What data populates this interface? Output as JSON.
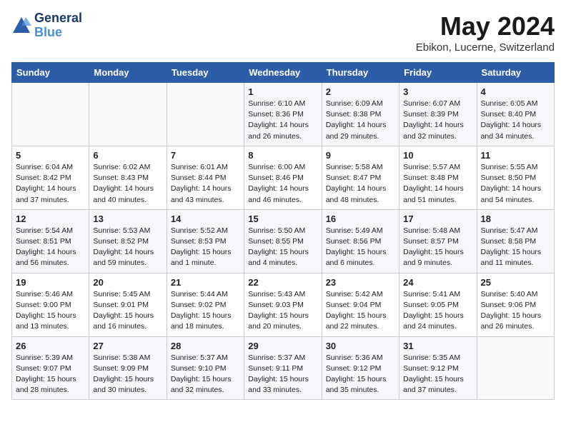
{
  "header": {
    "logo_line1": "General",
    "logo_line2": "Blue",
    "month": "May 2024",
    "location": "Ebikon, Lucerne, Switzerland"
  },
  "days_of_week": [
    "Sunday",
    "Monday",
    "Tuesday",
    "Wednesday",
    "Thursday",
    "Friday",
    "Saturday"
  ],
  "weeks": [
    [
      {
        "day": "",
        "content": ""
      },
      {
        "day": "",
        "content": ""
      },
      {
        "day": "",
        "content": ""
      },
      {
        "day": "1",
        "content": "Sunrise: 6:10 AM\nSunset: 8:36 PM\nDaylight: 14 hours\nand 26 minutes."
      },
      {
        "day": "2",
        "content": "Sunrise: 6:09 AM\nSunset: 8:38 PM\nDaylight: 14 hours\nand 29 minutes."
      },
      {
        "day": "3",
        "content": "Sunrise: 6:07 AM\nSunset: 8:39 PM\nDaylight: 14 hours\nand 32 minutes."
      },
      {
        "day": "4",
        "content": "Sunrise: 6:05 AM\nSunset: 8:40 PM\nDaylight: 14 hours\nand 34 minutes."
      }
    ],
    [
      {
        "day": "5",
        "content": "Sunrise: 6:04 AM\nSunset: 8:42 PM\nDaylight: 14 hours\nand 37 minutes."
      },
      {
        "day": "6",
        "content": "Sunrise: 6:02 AM\nSunset: 8:43 PM\nDaylight: 14 hours\nand 40 minutes."
      },
      {
        "day": "7",
        "content": "Sunrise: 6:01 AM\nSunset: 8:44 PM\nDaylight: 14 hours\nand 43 minutes."
      },
      {
        "day": "8",
        "content": "Sunrise: 6:00 AM\nSunset: 8:46 PM\nDaylight: 14 hours\nand 46 minutes."
      },
      {
        "day": "9",
        "content": "Sunrise: 5:58 AM\nSunset: 8:47 PM\nDaylight: 14 hours\nand 48 minutes."
      },
      {
        "day": "10",
        "content": "Sunrise: 5:57 AM\nSunset: 8:48 PM\nDaylight: 14 hours\nand 51 minutes."
      },
      {
        "day": "11",
        "content": "Sunrise: 5:55 AM\nSunset: 8:50 PM\nDaylight: 14 hours\nand 54 minutes."
      }
    ],
    [
      {
        "day": "12",
        "content": "Sunrise: 5:54 AM\nSunset: 8:51 PM\nDaylight: 14 hours\nand 56 minutes."
      },
      {
        "day": "13",
        "content": "Sunrise: 5:53 AM\nSunset: 8:52 PM\nDaylight: 14 hours\nand 59 minutes."
      },
      {
        "day": "14",
        "content": "Sunrise: 5:52 AM\nSunset: 8:53 PM\nDaylight: 15 hours\nand 1 minute."
      },
      {
        "day": "15",
        "content": "Sunrise: 5:50 AM\nSunset: 8:55 PM\nDaylight: 15 hours\nand 4 minutes."
      },
      {
        "day": "16",
        "content": "Sunrise: 5:49 AM\nSunset: 8:56 PM\nDaylight: 15 hours\nand 6 minutes."
      },
      {
        "day": "17",
        "content": "Sunrise: 5:48 AM\nSunset: 8:57 PM\nDaylight: 15 hours\nand 9 minutes."
      },
      {
        "day": "18",
        "content": "Sunrise: 5:47 AM\nSunset: 8:58 PM\nDaylight: 15 hours\nand 11 minutes."
      }
    ],
    [
      {
        "day": "19",
        "content": "Sunrise: 5:46 AM\nSunset: 9:00 PM\nDaylight: 15 hours\nand 13 minutes."
      },
      {
        "day": "20",
        "content": "Sunrise: 5:45 AM\nSunset: 9:01 PM\nDaylight: 15 hours\nand 16 minutes."
      },
      {
        "day": "21",
        "content": "Sunrise: 5:44 AM\nSunset: 9:02 PM\nDaylight: 15 hours\nand 18 minutes."
      },
      {
        "day": "22",
        "content": "Sunrise: 5:43 AM\nSunset: 9:03 PM\nDaylight: 15 hours\nand 20 minutes."
      },
      {
        "day": "23",
        "content": "Sunrise: 5:42 AM\nSunset: 9:04 PM\nDaylight: 15 hours\nand 22 minutes."
      },
      {
        "day": "24",
        "content": "Sunrise: 5:41 AM\nSunset: 9:05 PM\nDaylight: 15 hours\nand 24 minutes."
      },
      {
        "day": "25",
        "content": "Sunrise: 5:40 AM\nSunset: 9:06 PM\nDaylight: 15 hours\nand 26 minutes."
      }
    ],
    [
      {
        "day": "26",
        "content": "Sunrise: 5:39 AM\nSunset: 9:07 PM\nDaylight: 15 hours\nand 28 minutes."
      },
      {
        "day": "27",
        "content": "Sunrise: 5:38 AM\nSunset: 9:09 PM\nDaylight: 15 hours\nand 30 minutes."
      },
      {
        "day": "28",
        "content": "Sunrise: 5:37 AM\nSunset: 9:10 PM\nDaylight: 15 hours\nand 32 minutes."
      },
      {
        "day": "29",
        "content": "Sunrise: 5:37 AM\nSunset: 9:11 PM\nDaylight: 15 hours\nand 33 minutes."
      },
      {
        "day": "30",
        "content": "Sunrise: 5:36 AM\nSunset: 9:12 PM\nDaylight: 15 hours\nand 35 minutes."
      },
      {
        "day": "31",
        "content": "Sunrise: 5:35 AM\nSunset: 9:12 PM\nDaylight: 15 hours\nand 37 minutes."
      },
      {
        "day": "",
        "content": ""
      }
    ]
  ]
}
